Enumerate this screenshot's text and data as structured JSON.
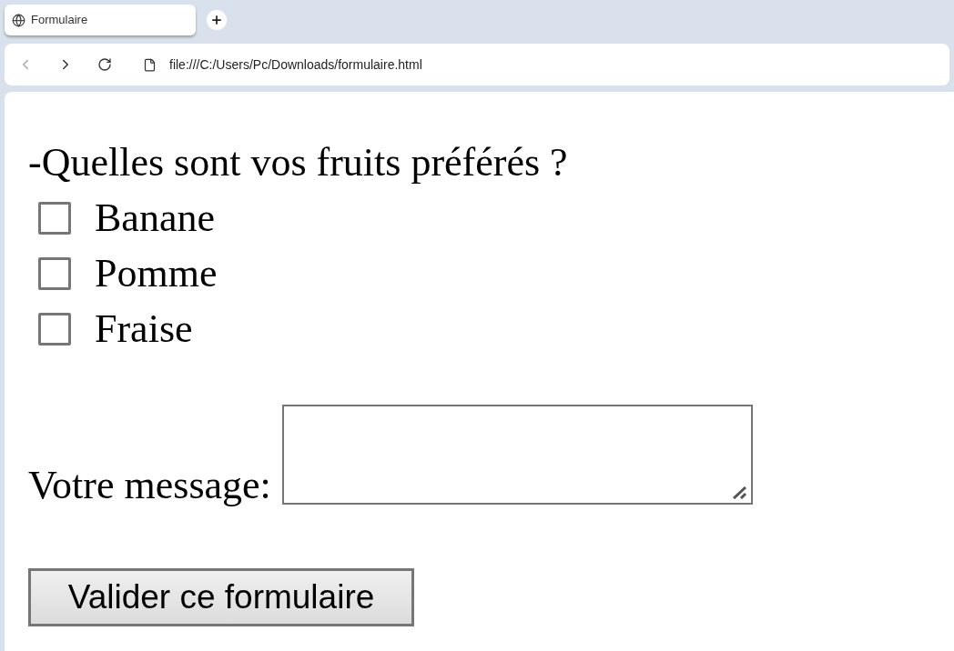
{
  "tab": {
    "title": "Formulaire"
  },
  "address_bar": {
    "url": "file:///C:/Users/Pc/Downloads/formulaire.html"
  },
  "form": {
    "question": "-Quelles sont vos fruits préférés ?",
    "options": [
      {
        "label": "Banane",
        "checked": false
      },
      {
        "label": "Pomme",
        "checked": false
      },
      {
        "label": "Fraise",
        "checked": false
      }
    ],
    "message_label": "Votre message:",
    "submit": "Valider ce formulaire"
  }
}
